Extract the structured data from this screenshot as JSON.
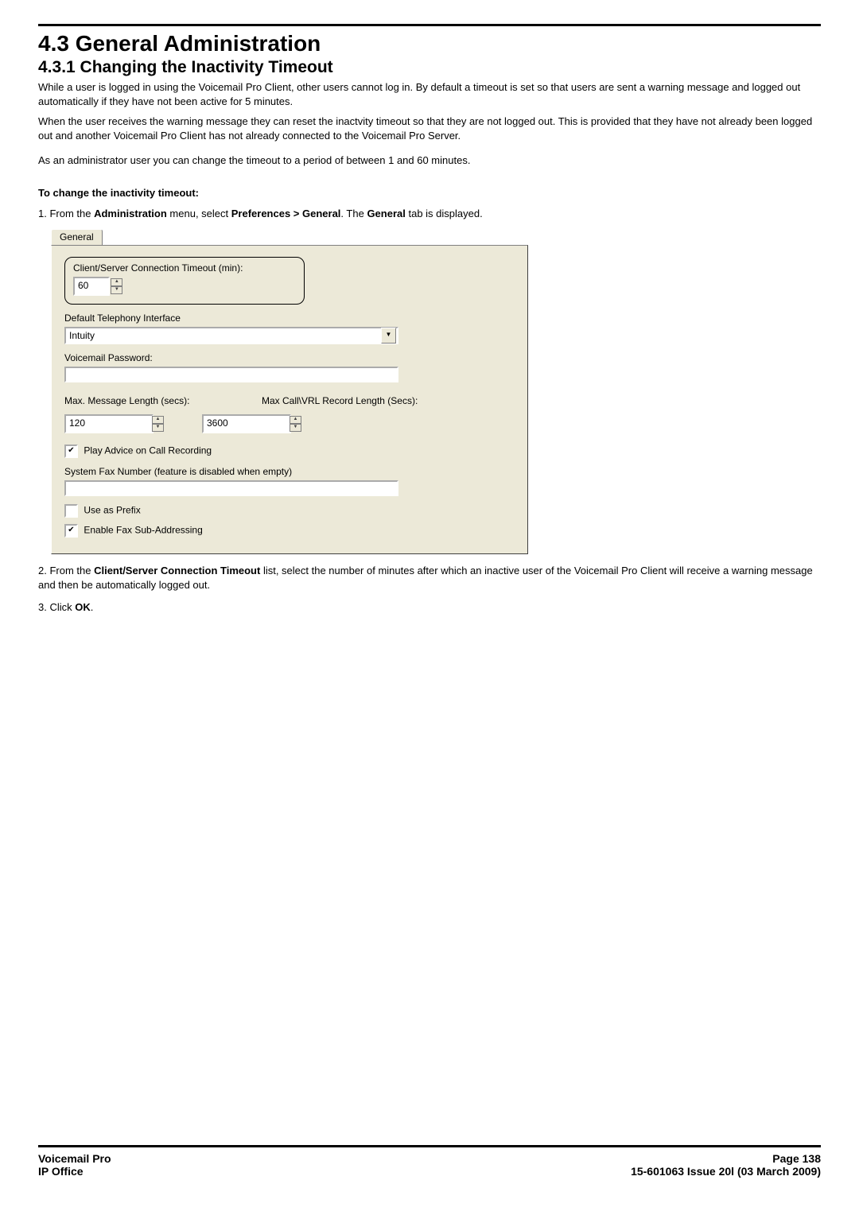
{
  "heading1": "4.3 General Administration",
  "heading2": "4.3.1 Changing the Inactivity Timeout",
  "p1": "While a user is logged in using the Voicemail Pro Client, other users cannot log in. By default a timeout is set so that users are sent a warning message and logged out automatically if they have not been active for 5 minutes.",
  "p2": "When the user receives the warning message they can reset the inactvity timeout so that they are not logged out. This is provided that they have not already been logged out and another Voicemail Pro Client has not already connected to the Voicemail Pro Server.",
  "p3": "As an administrator user you can change the timeout to a period of between 1 and 60 minutes.",
  "procTitle": "To change the inactivity timeout:",
  "step1": {
    "prefix": "1. From the ",
    "b1": "Administration",
    "mid": " menu, select ",
    "b2": "Preferences > General",
    "mid2": ". The ",
    "b3": "General",
    "suffix": " tab is displayed."
  },
  "dialog": {
    "tab": "General",
    "timeoutGroupLabel": "Client/Server Connection Timeout (min):",
    "timeoutValue": "60",
    "dtiLabel": "Default Telephony Interface",
    "dtiValue": "Intuity",
    "vmPwdLabel": "Voicemail Password:",
    "vmPwdValue": "",
    "maxMsgLabel": "Max. Message Length (secs):",
    "maxVrlLabel": "Max Call\\VRL Record Length (Secs):",
    "maxMsgValue": "120",
    "maxVrlValue": "3600",
    "cbPlayAdvice": "Play Advice on Call Recording",
    "cbPlayAdviceChecked": true,
    "sysFaxLabel": "System Fax Number (feature is disabled when empty)",
    "sysFaxValue": "",
    "cbUsePrefix": "Use as Prefix",
    "cbUsePrefixChecked": false,
    "cbEnableFaxSub": "Enable Fax Sub-Addressing",
    "cbEnableFaxSubChecked": true
  },
  "step2": {
    "prefix": "2. From the ",
    "b1": "Client/Server Connection Timeout",
    "suffix": " list, select the number of minutes after which an inactive user of the Voicemail Pro Client will receive a warning message and then be automatically logged out."
  },
  "step3": {
    "prefix": "3. Click ",
    "b1": "OK",
    "suffix": "."
  },
  "footer": {
    "leftTop": "Voicemail Pro",
    "leftBottom": "IP Office",
    "rightTop": "Page 138",
    "rightBottom": "15-601063 Issue 20l (03 March 2009)"
  }
}
